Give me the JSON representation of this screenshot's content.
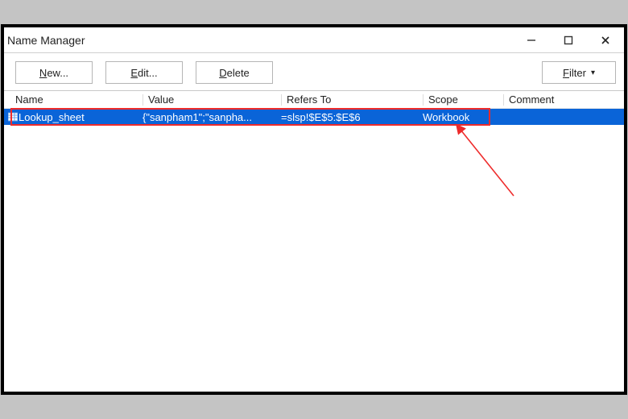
{
  "window": {
    "title": "Name Manager"
  },
  "toolbar": {
    "new_label": "New...",
    "new_accel": "N",
    "edit_label": "Edit...",
    "edit_accel": "E",
    "delete_label": "Delete",
    "delete_accel": "D",
    "filter_label": "Filter",
    "filter_accel": "F"
  },
  "columns": {
    "name": "Name",
    "value": "Value",
    "refers_to": "Refers To",
    "scope": "Scope",
    "comment": "Comment"
  },
  "rows": [
    {
      "name": "Lookup_sheet",
      "value": "{\"sanpham1\";\"sanpha...",
      "refers_to": "=slsp!$E$5:$E$6",
      "scope": "Workbook",
      "comment": ""
    }
  ],
  "annotation": {
    "highlight_row_index": 0
  }
}
